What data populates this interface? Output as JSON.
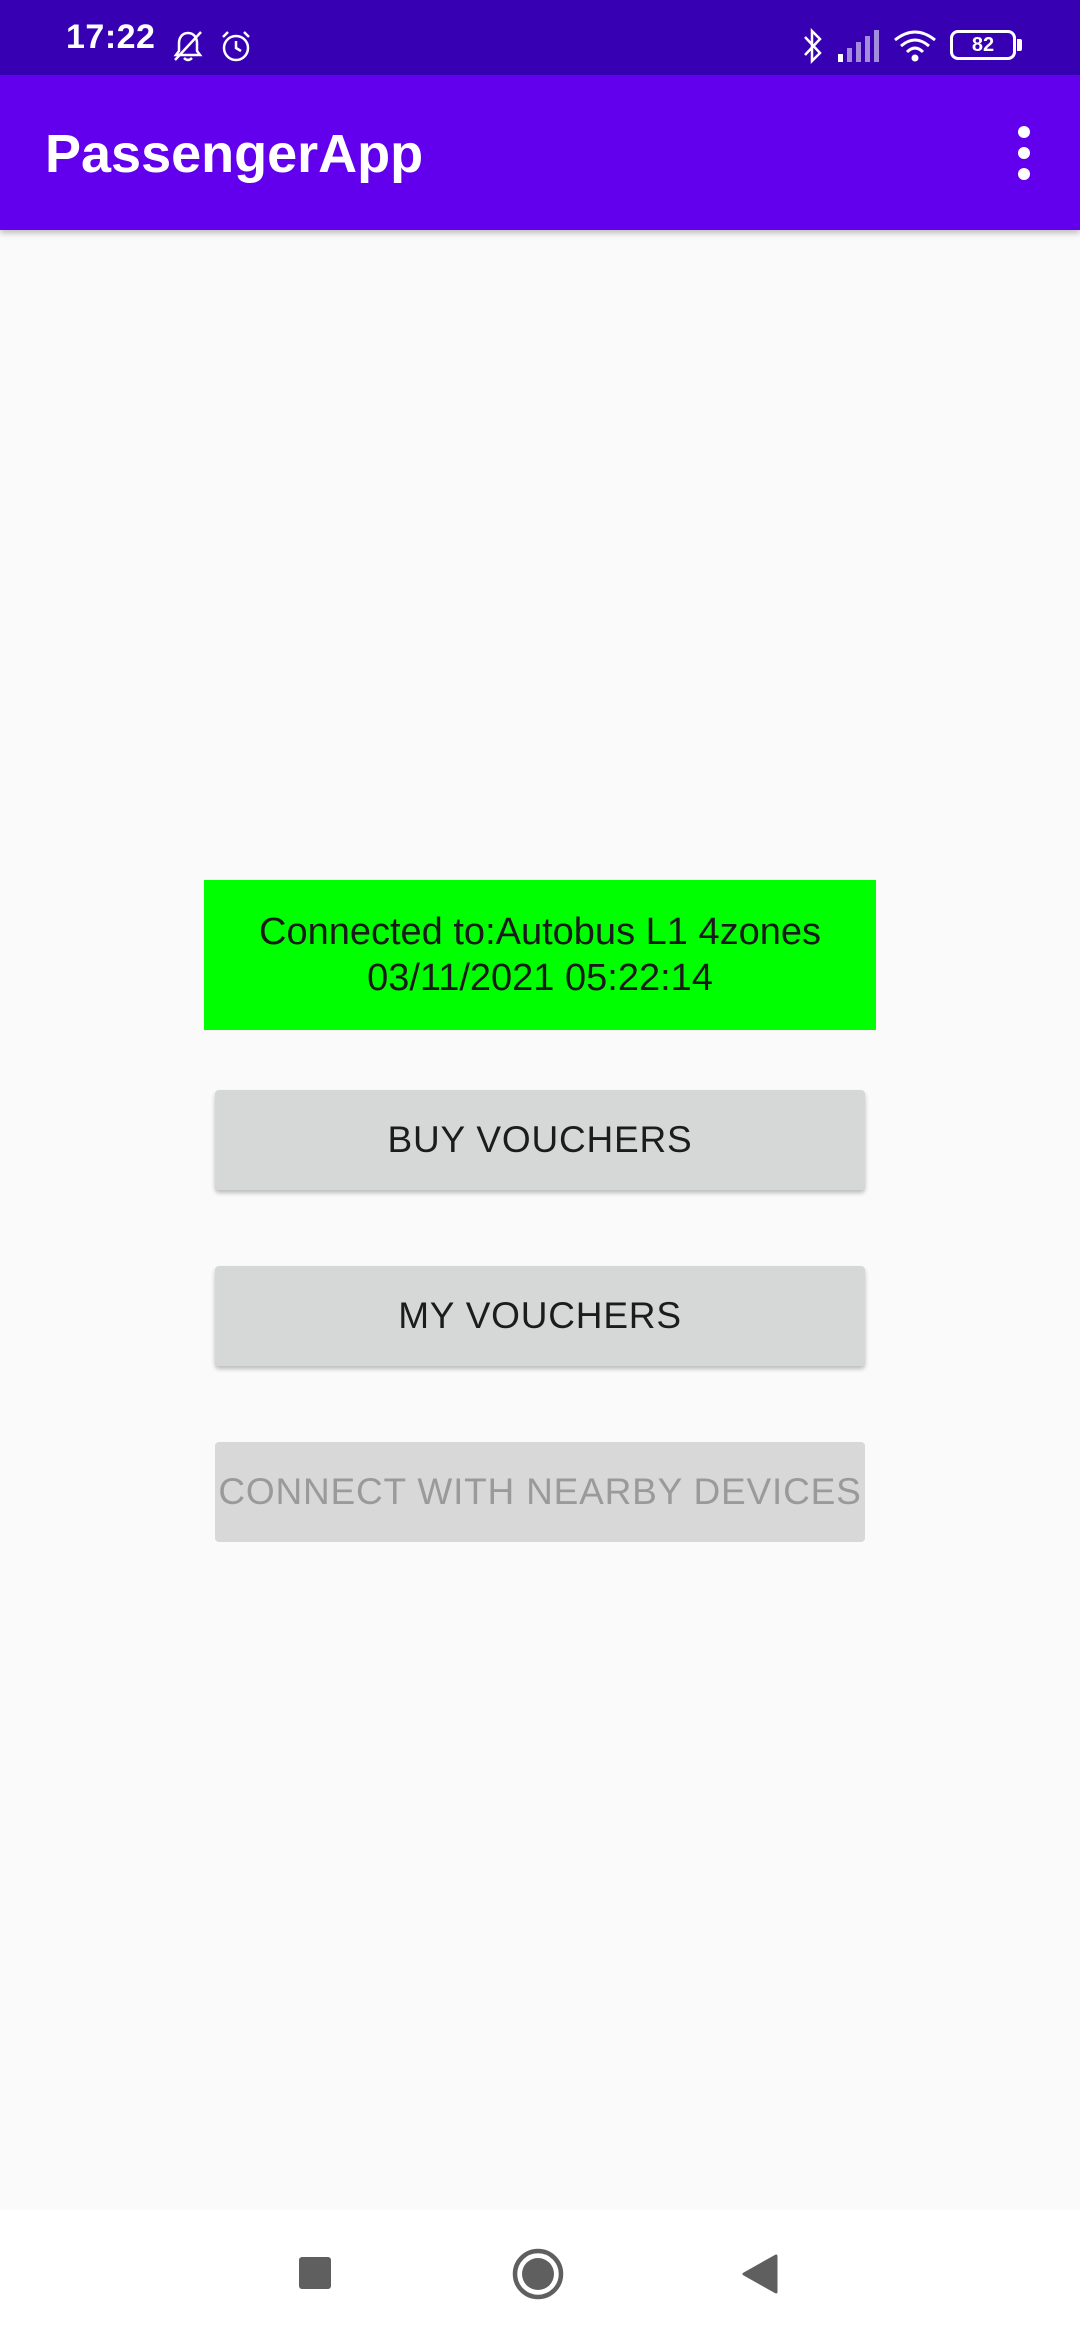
{
  "status_bar": {
    "time": "17:22",
    "battery": "82",
    "icons": [
      "bell-off-icon",
      "alarm-icon",
      "bluetooth-icon",
      "signal-icon",
      "wifi-icon",
      "battery-icon"
    ]
  },
  "app_bar": {
    "title": "PassengerApp",
    "menu_icon": "overflow-menu-icon"
  },
  "connection": {
    "line1": "Connected to:Autobus L1 4zones",
    "line2": "03/11/2021 05:22:14"
  },
  "buttons": {
    "buy_vouchers": "BUY VOUCHERS",
    "my_vouchers": "MY VOUCHERS",
    "connect_nearby": "CONNECT WITH NEARBY DEVICES"
  },
  "nav_bar": {
    "icons": [
      "recents-icon",
      "home-icon",
      "back-icon"
    ]
  },
  "colors": {
    "status_bar": "#3700b3",
    "app_bar": "#6200ee",
    "banner": "#00ff00",
    "button": "#d6d7d7",
    "background": "#fafafa"
  }
}
